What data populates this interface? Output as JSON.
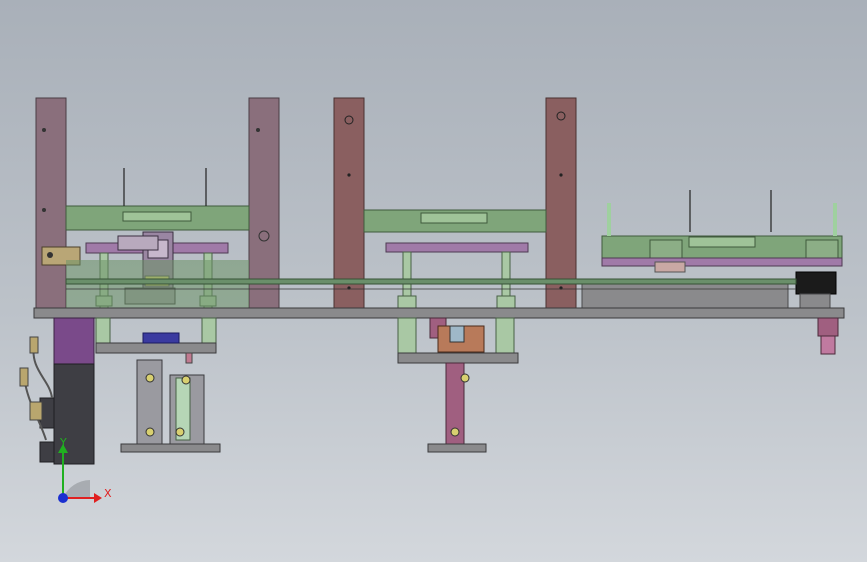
{
  "viewport": {
    "background_top": "#a9b0b9",
    "background_bottom": "#d3d7dc"
  },
  "triad": {
    "x_label": "X",
    "y_label": "Y",
    "x_color": "#e02020",
    "y_color": "#20b020",
    "z_color": "#1a2fd0"
  },
  "palette": {
    "frame": "#8a6f7c",
    "frame_dark": "#7d5f6a",
    "rail_green": "#7fa57a",
    "purple_plate": "#a07aa8",
    "base_gray": "#8a8a8c",
    "post_green": "#a9c8a4",
    "motor_purple": "#7a4a8a",
    "motor_body": "#3e3e44"
  }
}
